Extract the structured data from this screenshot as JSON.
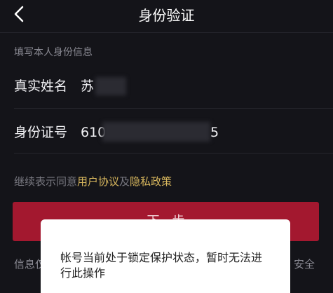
{
  "header": {
    "title": "身份验证"
  },
  "form": {
    "section_label": "填写本人身份信息",
    "name_label": "真实姓名",
    "name_value": "苏",
    "id_label": "身份证号",
    "id_prefix": "610",
    "id_suffix": "5"
  },
  "agreement": {
    "prefix": "继续表示同意",
    "user_agreement": "用户协议",
    "and": "及",
    "privacy_policy": "隐私政策"
  },
  "next_button": {
    "label": "下一步"
  },
  "footer": {
    "left": "信息仅",
    "right": "安全"
  },
  "toast": {
    "message": "帐号当前处于锁定保护状态，暂时无法进行此操作"
  },
  "colors": {
    "accent": "#a3182f",
    "link": "#d9b85e",
    "background": "#141419"
  }
}
